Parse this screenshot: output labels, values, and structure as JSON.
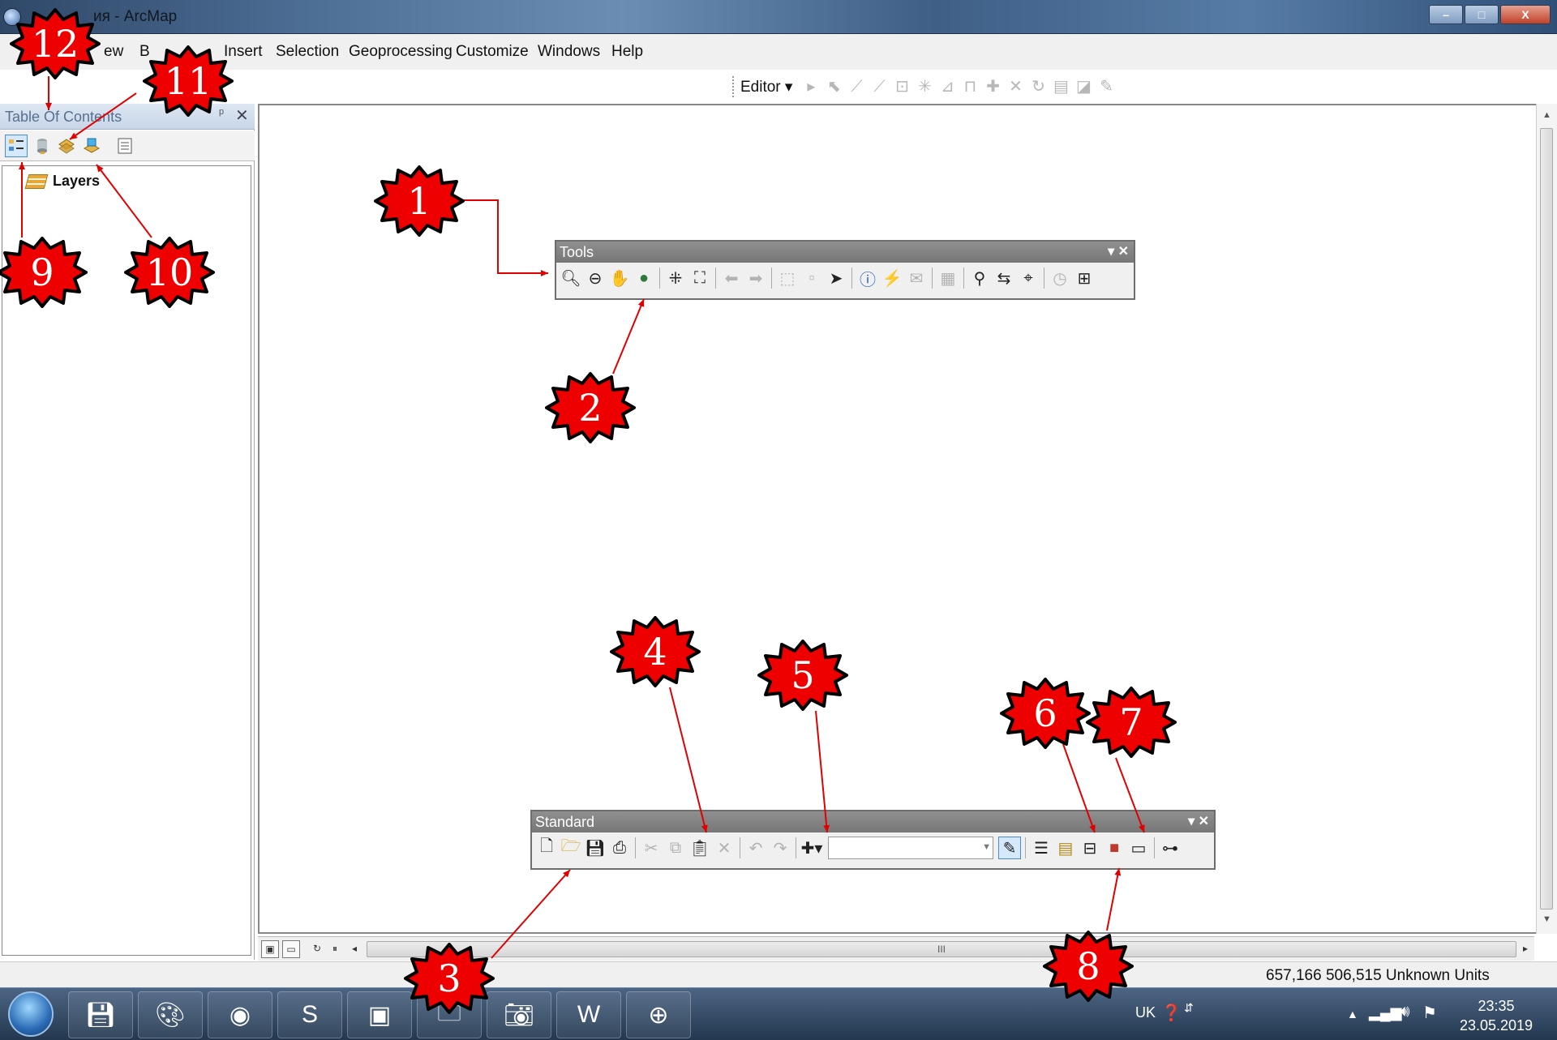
{
  "window": {
    "title": "ия - ArcMap",
    "min": "–",
    "max": "□",
    "close": "X"
  },
  "menu": [
    "ew",
    "B",
    "Insert",
    "Selection",
    "Geoprocessing",
    "Customize",
    "Windows",
    "Help"
  ],
  "editor": {
    "label": "Editor ▾"
  },
  "toc": {
    "title": "Table Of Contents",
    "pin": "ᵖ",
    "close": "✕",
    "layers_label": "Layers"
  },
  "tools_toolbar": {
    "title": "Tools",
    "controls": "▾ ✕"
  },
  "standard_toolbar": {
    "title": "Standard",
    "controls": "▾ ✕"
  },
  "status": {
    "coords": "657,166  506,515 Unknown Units"
  },
  "hscroll": {
    "thumb_grip": "III"
  },
  "taskbar": {
    "lang": "UK",
    "time": "23:35",
    "date": "23.05.2019"
  },
  "annotations": [
    "1",
    "2",
    "3",
    "4",
    "5",
    "6",
    "7",
    "8",
    "9",
    "10",
    "11",
    "12"
  ],
  "colors": {
    "badge_fill": "#ee0000",
    "arrow": "#e00000",
    "title_gray": "#808080"
  }
}
